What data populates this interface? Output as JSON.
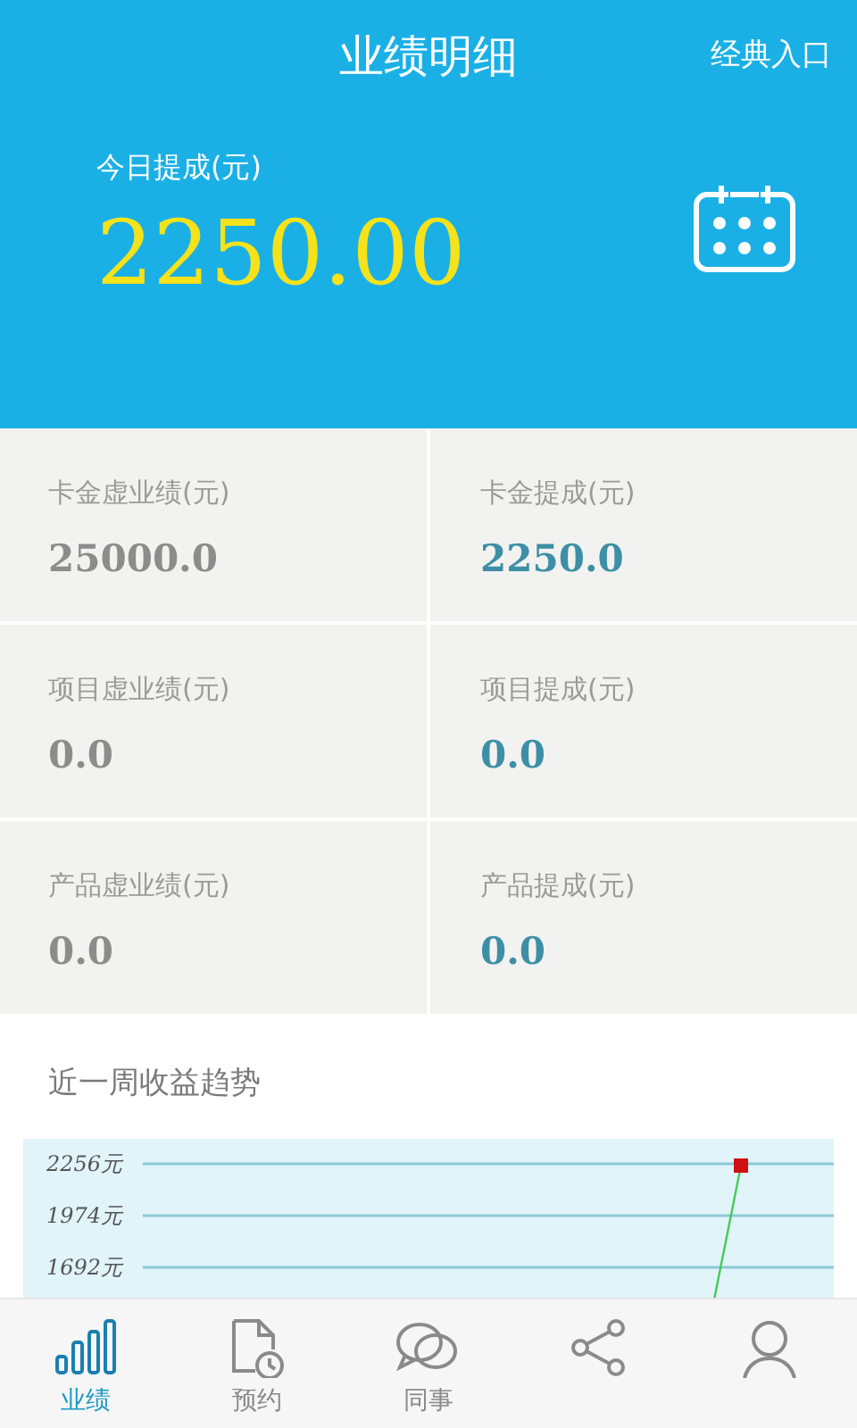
{
  "header": {
    "title": "业绩明细",
    "link": "经典入口",
    "today_label": "今日提成(元)",
    "today_value": "2250.00"
  },
  "stats": [
    {
      "label": "卡金虚业绩(元)",
      "value": "25000.0",
      "kind": "performance"
    },
    {
      "label": "卡金提成(元)",
      "value": "2250.0",
      "kind": "commission"
    },
    {
      "label": "项目虚业绩(元)",
      "value": "0.0",
      "kind": "performance"
    },
    {
      "label": "项目提成(元)",
      "value": "0.0",
      "kind": "commission"
    },
    {
      "label": "产品虚业绩(元)",
      "value": "0.0",
      "kind": "performance"
    },
    {
      "label": "产品提成(元)",
      "value": "0.0",
      "kind": "commission"
    }
  ],
  "trend": {
    "title": "近一周收益趋势",
    "axis_labels": [
      "2256元",
      "1974元",
      "1692元"
    ]
  },
  "tabs": [
    {
      "label": "业绩",
      "selected": true
    },
    {
      "label": "预约",
      "selected": false
    },
    {
      "label": "同事",
      "selected": false
    },
    {
      "selected": false
    },
    {
      "selected": false
    }
  ]
}
